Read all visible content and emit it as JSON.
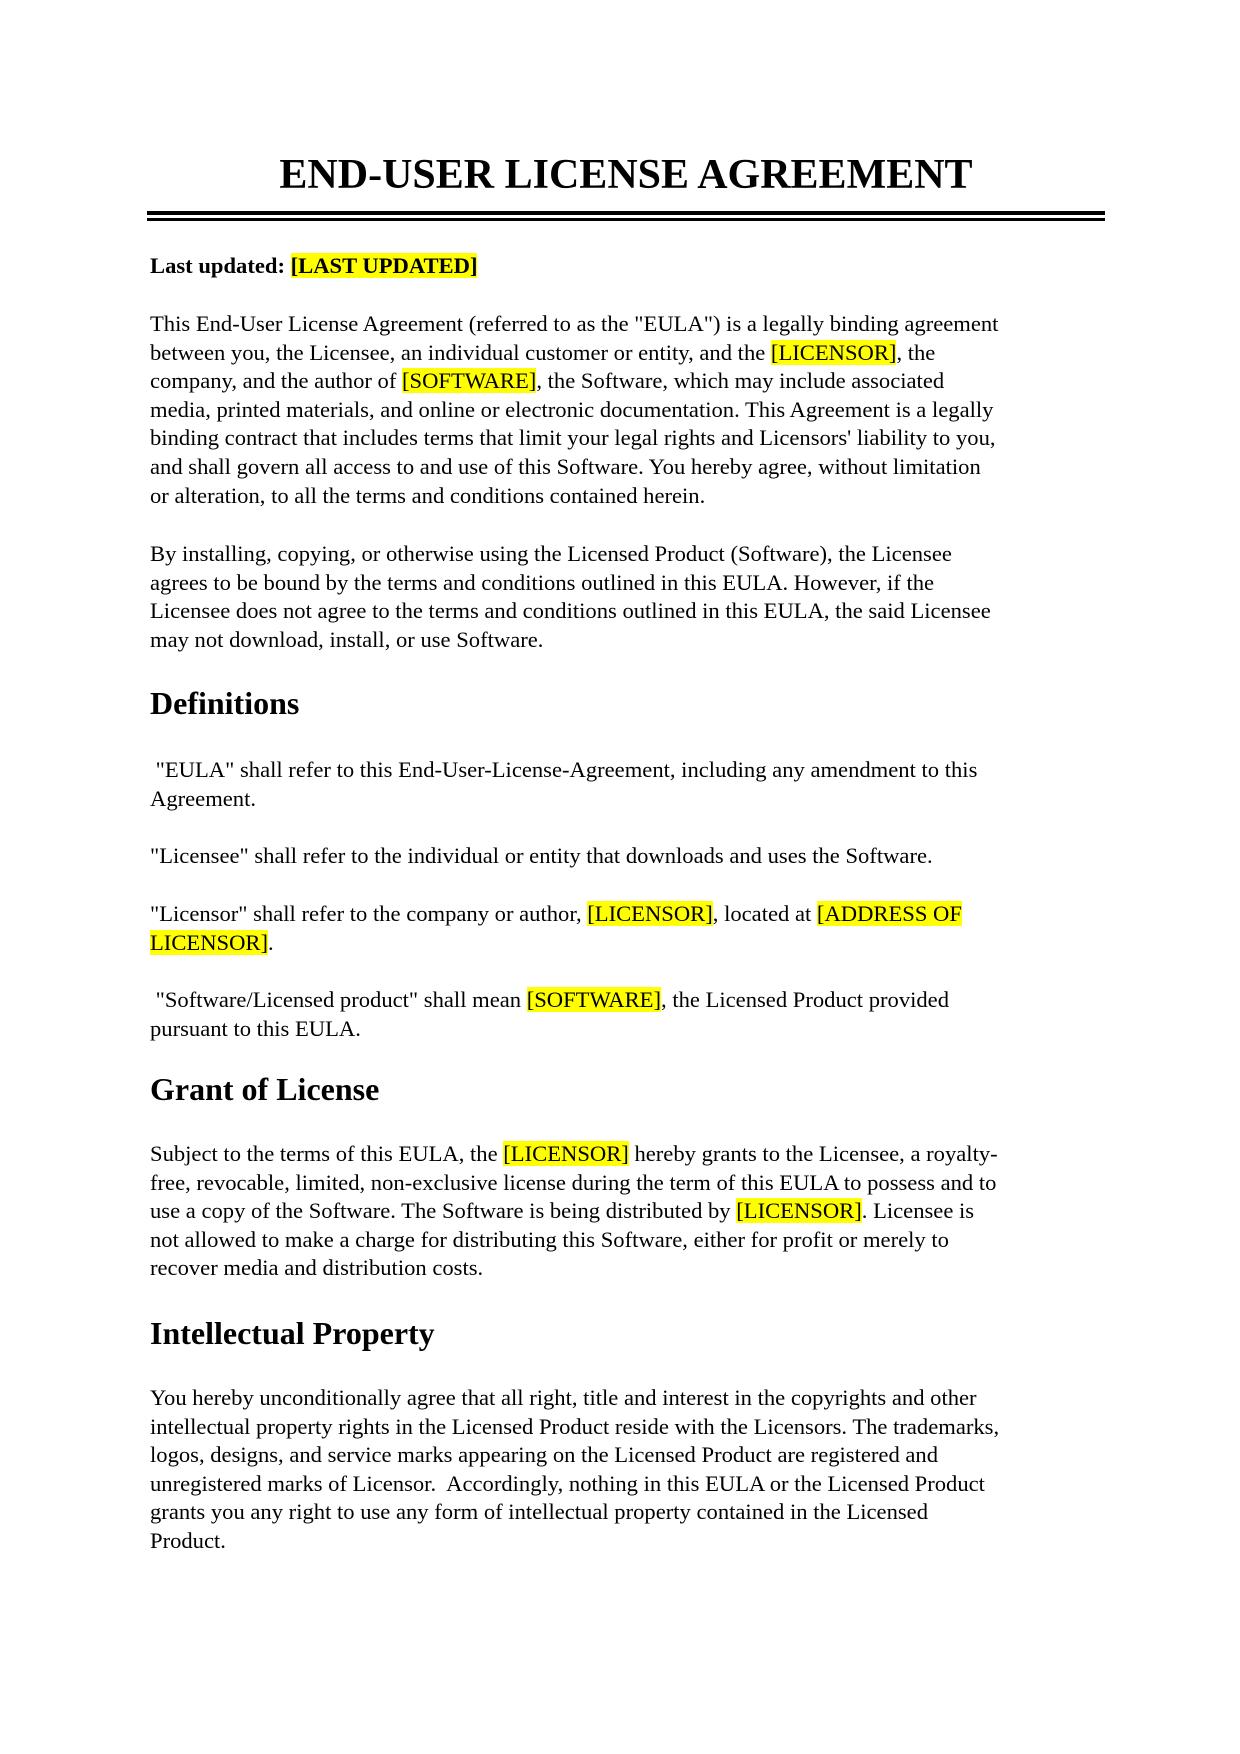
{
  "document": {
    "title": "END-USER LICENSE AGREEMENT",
    "last_updated": {
      "label": "Last updated: ",
      "value": "[LAST UPDATED]"
    },
    "highlight_color": "#ffff00",
    "intro": {
      "p1": {
        "l1": "This End-User License Agreement (referred to as the \"EULA\") is a legally binding agreement",
        "l2a": "between you, the Licensee, an individual customer or entity, and the ",
        "l2hl": "[LICENSOR]",
        "l2b": ", the",
        "l3a": "company, and the author of ",
        "l3hl": "[SOFTWARE]",
        "l3b": ", the Software, which may include associated",
        "l4": "media, printed materials, and online or electronic documentation. This Agreement is a legally",
        "l5": "binding contract that includes terms that limit your legal rights and Licensors' liability to you,",
        "l6": "and shall govern all access to and use of this Software. You hereby agree, without limitation",
        "l7": "or alteration, to all the terms and conditions contained herein."
      },
      "p2": {
        "l1": "By installing, copying, or otherwise using the Licensed Product (Software), the Licensee",
        "l2": "agrees to be bound by the terms and conditions outlined in this EULA. However, if the",
        "l3": "Licensee does not agree to the terms and conditions outlined in this EULA, the said Licensee",
        "l4": "may not download, install, or use Software."
      }
    },
    "definitions": {
      "heading": "Definitions",
      "eula": {
        "l1": " \"EULA\" shall refer to this End-User-License-Agreement, including any amendment to this",
        "l2": "Agreement."
      },
      "licensee": {
        "l1": "\"Licensee\" shall refer to the individual or entity that downloads and uses the Software."
      },
      "licensor": {
        "l1a": "\"Licensor\" shall refer to the company or author, ",
        "l1hl": "[LICENSOR]",
        "l1b": ", located at ",
        "l1hl2": "[ADDRESS OF",
        "l2hl": "LICENSOR]",
        "l2b": "."
      },
      "software": {
        "l1a": " \"Software/Licensed product\" shall mean ",
        "l1hl": "[SOFTWARE]",
        "l1b": ", the Licensed Product provided",
        "l2": "pursuant to this EULA."
      }
    },
    "grant": {
      "heading": "Grant of License",
      "l1a": "Subject to the terms of this EULA, the ",
      "l1hl": "[LICENSOR]",
      "l1b": " hereby grants to the Licensee, a royalty-",
      "l2": "free, revocable, limited, non-exclusive license during the term of this EULA to possess and to",
      "l3a": "use a copy of the Software. The Software is being distributed by ",
      "l3hl": "[LICENSOR]",
      "l3b": ". Licensee is",
      "l4": "not allowed to make a charge for distributing this Software, either for profit or merely to",
      "l5": "recover media and distribution costs."
    },
    "ip": {
      "heading": "Intellectual Property",
      "l1": "You hereby unconditionally agree that all right, title and interest in the copyrights and other",
      "l2": "intellectual property rights in the Licensed Product reside with the Licensors. The trademarks,",
      "l3": "logos, designs, and service marks appearing on the Licensed Product are registered and",
      "l4": "unregistered marks of Licensor.  Accordingly, nothing in this EULA or the Licensed Product",
      "l5": "grants you any right to use any form of intellectual property contained in the Licensed",
      "l6": "Product."
    }
  }
}
